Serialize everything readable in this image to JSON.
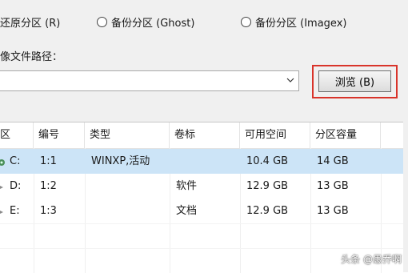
{
  "options": {
    "restore_label": "还原分区 (R)",
    "backup_ghost_label": "备份分区 (Ghost)",
    "backup_imagex_label": "备份分区 (Imagex)"
  },
  "path_section": {
    "label": "像文件路径：",
    "value": "",
    "browse_label": "浏览 (B)"
  },
  "table": {
    "headers": [
      "区",
      "编号",
      "类型",
      "卷标",
      "可用空间",
      "分区容量"
    ],
    "rows": [
      {
        "drive": "C:",
        "number": "1:1",
        "type": "WINXP,活动",
        "label": "",
        "free": "10.4 GB",
        "size": "14 GB"
      },
      {
        "drive": "D:",
        "number": "1:2",
        "type": "",
        "label": "软件",
        "free": "12.9 GB",
        "size": "13 GB"
      },
      {
        "drive": "E:",
        "number": "1:3",
        "type": "",
        "label": "文档",
        "free": "12.9 GB",
        "size": "13 GB"
      }
    ]
  },
  "watermark": "头条 @愚乔啊",
  "colors": {
    "highlight_border": "#d9342b",
    "selected_row": "#cce4f7"
  }
}
